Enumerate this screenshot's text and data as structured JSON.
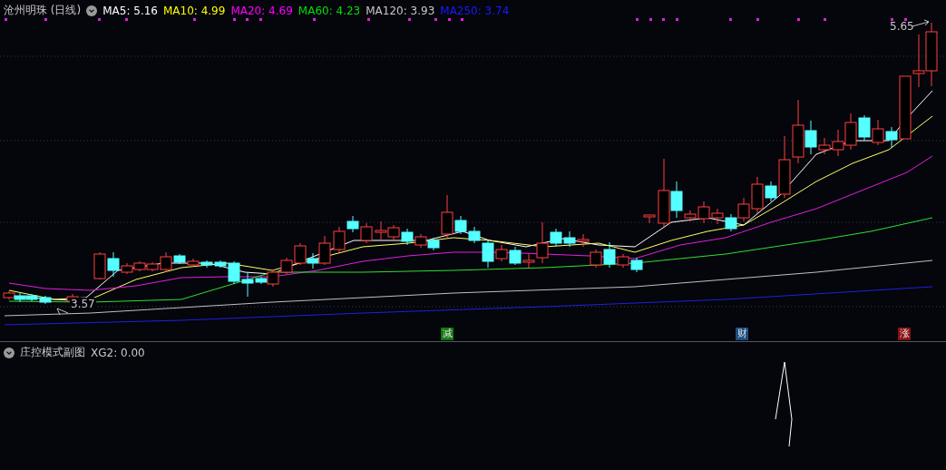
{
  "title": "沧州明珠 (日线)",
  "ma_legend": [
    {
      "label": "MA5: 5.16",
      "color": "#ffffff"
    },
    {
      "label": "MA10: 4.99",
      "color": "#ffff00"
    },
    {
      "label": "MA20: 4.69",
      "color": "#ff00ff"
    },
    {
      "label": "MA60: 4.23",
      "color": "#00e000"
    },
    {
      "label": "MA120: 3.93",
      "color": "#c8c8c8"
    },
    {
      "label": "MA250: 3.74",
      "color": "#1a1aff"
    }
  ],
  "price_marks": [
    {
      "kind": "high",
      "text": "5.65"
    },
    {
      "kind": "low",
      "text": "3.57"
    }
  ],
  "signals": [
    {
      "text": "减",
      "color": "#117711"
    },
    {
      "text": "财",
      "color": "#1c4d80"
    },
    {
      "text": "涨",
      "color": "#8a1010"
    }
  ],
  "sub_panel": {
    "title": "庄控模式副图",
    "indicator": "XG2: 0.00"
  }
}
